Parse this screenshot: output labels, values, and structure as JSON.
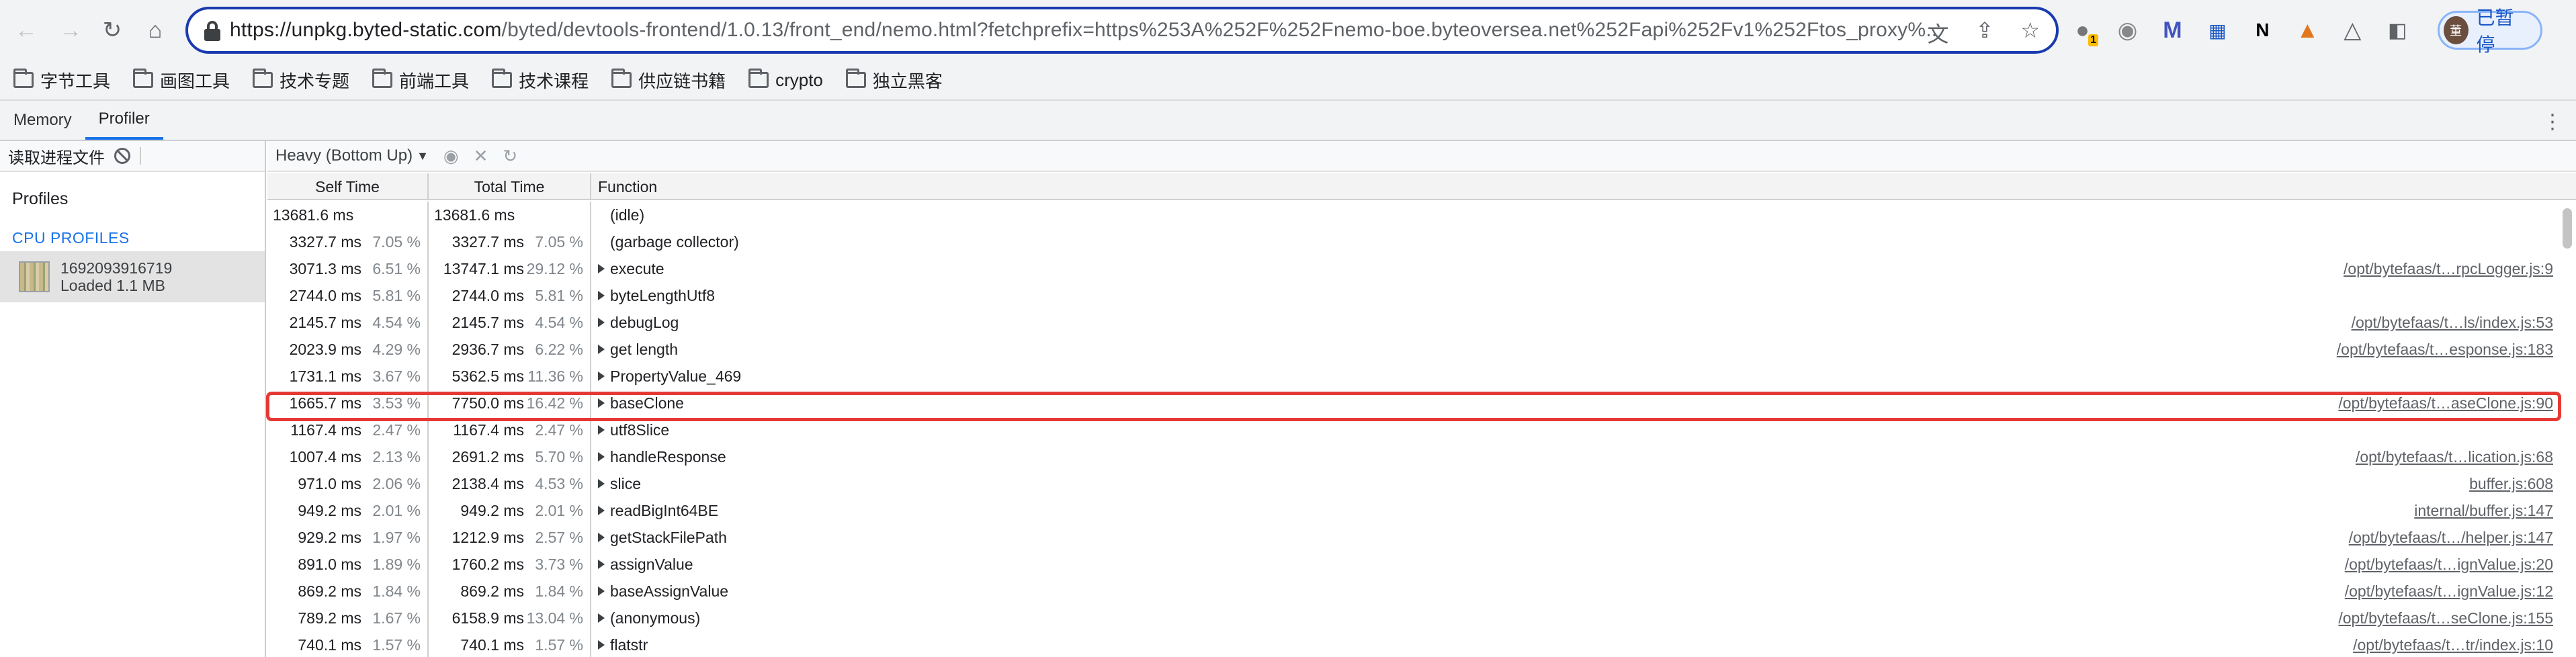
{
  "browser": {
    "url_host": "https://unpkg.byted-static.com",
    "url_rest": "/byted/devtools-frontend/1.0.13/front_end/nemo.html?fetchprefix=https%253A%252F%252Fnemo-boe.byteoversea.net%252Fapi%252Fv1%252Ftos_proxy%...",
    "profile_label": "已暂停",
    "avatar_text": "董",
    "extension_badge": "1"
  },
  "bookmarks": [
    "字节工具",
    "画图工具",
    "技术专题",
    "前端工具",
    "技术课程",
    "供应链书籍",
    "crypto",
    "独立黑客"
  ],
  "devtools": {
    "tabs": [
      "Memory",
      "Profiler"
    ],
    "active_tab": "Profiler"
  },
  "sidebar": {
    "load_label": "读取进程文件",
    "heading": "Profiles",
    "section": "CPU PROFILES",
    "profile_name": "1692093916719",
    "profile_status": "Loaded 1.1 MB"
  },
  "profiler": {
    "view_mode": "Heavy (Bottom Up)",
    "columns": [
      "Self Time",
      "Total Time",
      "Function"
    ],
    "rows": [
      {
        "self": "13681.6 ms",
        "self_pct": "",
        "total": "13681.6 ms",
        "total_pct": "",
        "func": "(idle)",
        "expandable": false,
        "src": ""
      },
      {
        "self": "3327.7 ms",
        "self_pct": "7.05 %",
        "total": "3327.7 ms",
        "total_pct": "7.05 %",
        "func": "(garbage collector)",
        "expandable": false,
        "src": ""
      },
      {
        "self": "3071.3 ms",
        "self_pct": "6.51 %",
        "total": "13747.1 ms",
        "total_pct": "29.12 %",
        "func": "execute",
        "expandable": true,
        "src": "/opt/bytefaas/t…rpcLogger.js:9"
      },
      {
        "self": "2744.0 ms",
        "self_pct": "5.81 %",
        "total": "2744.0 ms",
        "total_pct": "5.81 %",
        "func": "byteLengthUtf8",
        "expandable": true,
        "src": ""
      },
      {
        "self": "2145.7 ms",
        "self_pct": "4.54 %",
        "total": "2145.7 ms",
        "total_pct": "4.54 %",
        "func": "debugLog",
        "expandable": true,
        "src": "/opt/bytefaas/t…ls/index.js:53"
      },
      {
        "self": "2023.9 ms",
        "self_pct": "4.29 %",
        "total": "2936.7 ms",
        "total_pct": "6.22 %",
        "func": "get length",
        "expandable": true,
        "src": "/opt/bytefaas/t…esponse.js:183"
      },
      {
        "self": "1731.1 ms",
        "self_pct": "3.67 %",
        "total": "5362.5 ms",
        "total_pct": "11.36 %",
        "func": "PropertyValue_469",
        "expandable": true,
        "src": ""
      },
      {
        "self": "1665.7 ms",
        "self_pct": "3.53 %",
        "total": "7750.0 ms",
        "total_pct": "16.42 %",
        "func": "baseClone",
        "expandable": true,
        "src": "/opt/bytefaas/t…aseClone.js:90"
      },
      {
        "self": "1167.4 ms",
        "self_pct": "2.47 %",
        "total": "1167.4 ms",
        "total_pct": "2.47 %",
        "func": "utf8Slice",
        "expandable": true,
        "src": ""
      },
      {
        "self": "1007.4 ms",
        "self_pct": "2.13 %",
        "total": "2691.2 ms",
        "total_pct": "5.70 %",
        "func": "handleResponse",
        "expandable": true,
        "src": "/opt/bytefaas/t…lication.js:68"
      },
      {
        "self": "971.0 ms",
        "self_pct": "2.06 %",
        "total": "2138.4 ms",
        "total_pct": "4.53 %",
        "func": "slice",
        "expandable": true,
        "src": "buffer.js:608"
      },
      {
        "self": "949.2 ms",
        "self_pct": "2.01 %",
        "total": "949.2 ms",
        "total_pct": "2.01 %",
        "func": "readBigInt64BE",
        "expandable": true,
        "src": "internal/buffer.js:147"
      },
      {
        "self": "929.2 ms",
        "self_pct": "1.97 %",
        "total": "1212.9 ms",
        "total_pct": "2.57 %",
        "func": "getStackFilePath",
        "expandable": true,
        "src": "/opt/bytefaas/t…/helper.js:147"
      },
      {
        "self": "891.0 ms",
        "self_pct": "1.89 %",
        "total": "1760.2 ms",
        "total_pct": "3.73 %",
        "func": "assignValue",
        "expandable": true,
        "src": "/opt/bytefaas/t…ignValue.js:20"
      },
      {
        "self": "869.2 ms",
        "self_pct": "1.84 %",
        "total": "869.2 ms",
        "total_pct": "1.84 %",
        "func": "baseAssignValue",
        "expandable": true,
        "src": "/opt/bytefaas/t…ignValue.js:12"
      },
      {
        "self": "789.2 ms",
        "self_pct": "1.67 %",
        "total": "6158.9 ms",
        "total_pct": "13.04 %",
        "func": "(anonymous)",
        "expandable": true,
        "src": "/opt/bytefaas/t…seClone.js:155"
      },
      {
        "self": "740.1 ms",
        "self_pct": "1.57 %",
        "total": "740.1 ms",
        "total_pct": "1.57 %",
        "func": "flatstr",
        "expandable": true,
        "src": "/opt/bytefaas/t…tr/index.js:10"
      }
    ]
  },
  "colors": {
    "highlight": "#e53935",
    "accent": "#1a73e8"
  }
}
